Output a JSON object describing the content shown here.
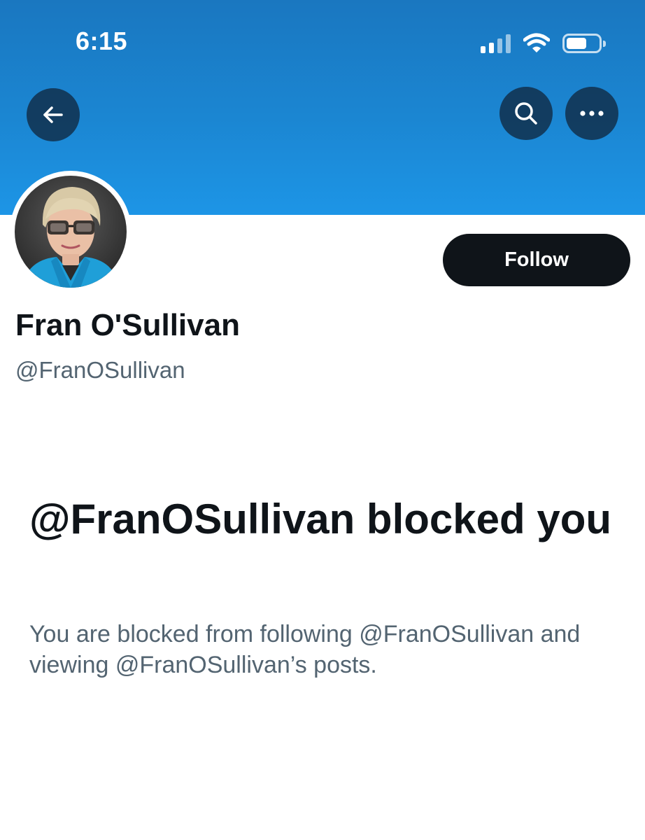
{
  "status_bar": {
    "time": "6:15"
  },
  "profile": {
    "display_name": "Fran O'Sullivan",
    "handle": "@FranOSullivan",
    "follow_label": "Follow"
  },
  "blocked": {
    "title": "@FranOSullivan blocked you",
    "description": "You are blocked from following @FranOSullivan and viewing @FranOSullivan’s posts."
  },
  "icons": {
    "back": "arrow-left-icon",
    "search": "search-icon",
    "more": "more-horizontal-icon"
  },
  "colors": {
    "banner": "#1b86d2",
    "follow_button": "#0f1419",
    "text_primary": "#0f1419",
    "text_secondary": "#536471"
  }
}
